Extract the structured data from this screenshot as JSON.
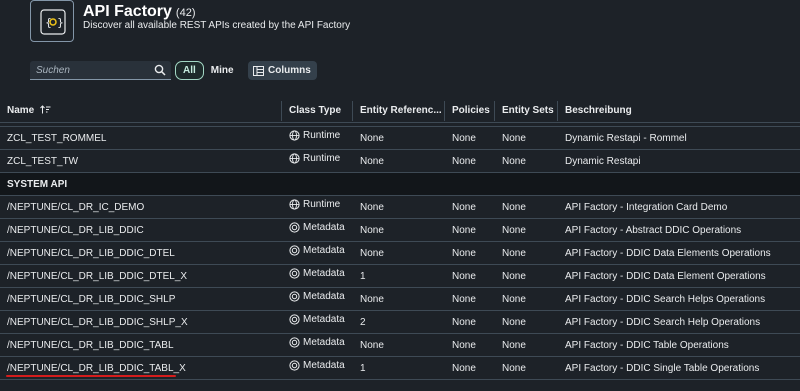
{
  "header": {
    "title": "API Factory",
    "count": "(42)",
    "subtitle": "Discover all available REST APIs created by the API Factory"
  },
  "toolbar": {
    "search_placeholder": "Suchen",
    "filter_all": "All",
    "filter_mine": "Mine",
    "columns_label": "Columns"
  },
  "columns": {
    "name": "Name",
    "class_type": "Class Type",
    "entity_references": "Entity Referenc...",
    "policies": "Policies",
    "entity_sets": "Entity Sets",
    "description": "Beschreibung"
  },
  "rows_top": [
    {
      "name": "ZCL_TEST_ROMMEL",
      "type": "Runtime",
      "icon": "globe-icon",
      "refs": "None",
      "policies": "None",
      "sets": "None",
      "desc": "Dynamic Restapi - Rommel"
    },
    {
      "name": "ZCL_TEST_TW",
      "type": "Runtime",
      "icon": "globe-icon",
      "refs": "None",
      "policies": "None",
      "sets": "None",
      "desc": "Dynamic Restapi"
    }
  ],
  "group": {
    "label": "SYSTEM API"
  },
  "rows_system": [
    {
      "name": "/NEPTUNE/CL_DR_IC_DEMO",
      "type": "Runtime",
      "icon": "globe-icon",
      "refs": "None",
      "policies": "None",
      "sets": "None",
      "desc": "API Factory - Integration Card Demo"
    },
    {
      "name": "/NEPTUNE/CL_DR_LIB_DDIC",
      "type": "Metadata",
      "icon": "metadata-icon",
      "refs": "None",
      "policies": "None",
      "sets": "None",
      "desc": "API Factory - Abstract DDIC Operations"
    },
    {
      "name": "/NEPTUNE/CL_DR_LIB_DDIC_DTEL",
      "type": "Metadata",
      "icon": "metadata-icon",
      "refs": "None",
      "policies": "None",
      "sets": "None",
      "desc": "API Factory - DDIC Data Elements Operations"
    },
    {
      "name": "/NEPTUNE/CL_DR_LIB_DDIC_DTEL_X",
      "type": "Metadata",
      "icon": "metadata-icon",
      "refs": "1",
      "policies": "None",
      "sets": "None",
      "desc": "API Factory - DDIC Data Element Operations"
    },
    {
      "name": "/NEPTUNE/CL_DR_LIB_DDIC_SHLP",
      "type": "Metadata",
      "icon": "metadata-icon",
      "refs": "None",
      "policies": "None",
      "sets": "None",
      "desc": "API Factory - DDIC Search Helps Operations"
    },
    {
      "name": "/NEPTUNE/CL_DR_LIB_DDIC_SHLP_X",
      "type": "Metadata",
      "icon": "metadata-icon",
      "refs": "2",
      "policies": "None",
      "sets": "None",
      "desc": "API Factory - DDIC Search Help Operations"
    },
    {
      "name": "/NEPTUNE/CL_DR_LIB_DDIC_TABL",
      "type": "Metadata",
      "icon": "metadata-icon",
      "refs": "None",
      "policies": "None",
      "sets": "None",
      "desc": "API Factory - DDIC Table Operations"
    },
    {
      "name": "/NEPTUNE/CL_DR_LIB_DDIC_TABL_X",
      "type": "Metadata",
      "icon": "metadata-icon",
      "refs": "1",
      "policies": "None",
      "sets": "None",
      "desc": "API Factory - DDIC Single Table Operations"
    }
  ]
}
